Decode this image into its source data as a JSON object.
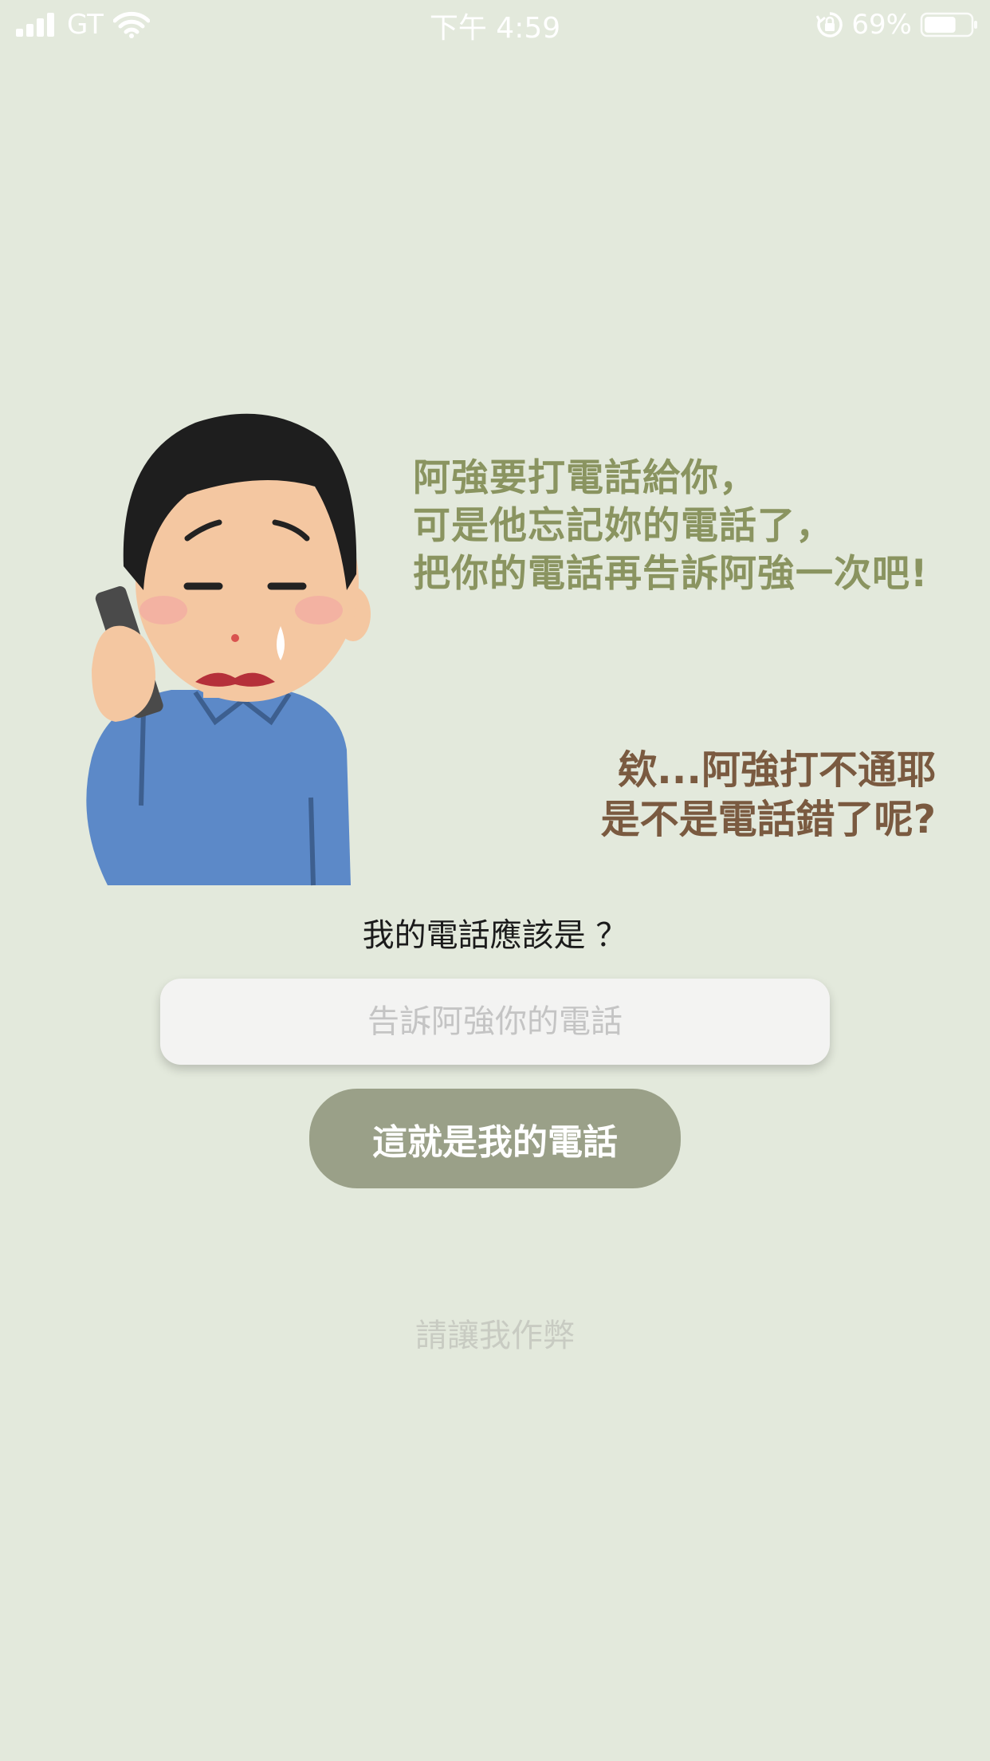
{
  "status_bar": {
    "carrier": "GT",
    "time": "下午 4:59",
    "battery": "69%",
    "battery_level": 0.69
  },
  "dialog": {
    "green_lines": [
      "阿強要打電話給你，",
      "可是他忘記妳的電話了，",
      "把你的電話再告訴阿強一次吧!"
    ],
    "brown_lines": [
      "欸...阿強打不通耶",
      "是不是電話錯了呢?"
    ]
  },
  "form": {
    "question": "我的電話應該是 ？",
    "input_placeholder": "告訴阿強你的電話",
    "input_value": "",
    "submit_label": "這就是我的電話",
    "cheat_label": "請讓我作弊"
  },
  "colors": {
    "background": "#e3e9dc",
    "green_text": "#8a9460",
    "brown_text": "#7a5a40",
    "button": "#9aa088"
  },
  "icons": [
    "signal-icon",
    "wifi-icon",
    "rotation-lock-icon",
    "battery-icon"
  ]
}
